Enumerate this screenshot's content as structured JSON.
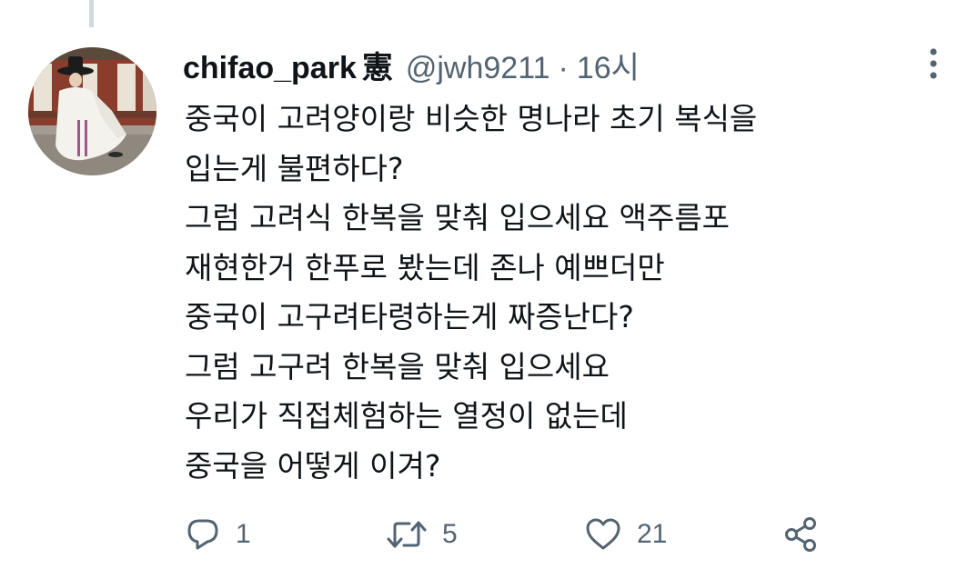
{
  "tweet": {
    "display_name": "chifao_park",
    "name_badge": "憲",
    "handle": "@jwh9211",
    "separator": "·",
    "time": "16시",
    "lines": [
      "중국이 고려양이랑 비슷한 명나라 초기 복식을",
      "입는게 불편하다?",
      "그럼 고려식 한복을 맞춰 입으세요 액주름포",
      "재현한거 한푸로 봤는데 존나 예쁘더만",
      "중국이 고구려타령하는게 짜증난다?",
      "그럼 고구려 한복을 맞춰 입으세요",
      "우리가 직접체험하는 열정이 없는데",
      "중국을 어떻게 이겨?"
    ]
  },
  "actions": {
    "reply": {
      "icon": "reply-icon",
      "count": "1"
    },
    "retweet": {
      "icon": "retweet-icon",
      "count": "5"
    },
    "like": {
      "icon": "heart-icon",
      "count": "21"
    },
    "share": {
      "icon": "share-icon"
    }
  },
  "more": {
    "icon": "more-vertical-icon"
  },
  "colors": {
    "text": "#0f1419",
    "secondary": "#536471",
    "thread_line": "#cfd9de"
  }
}
